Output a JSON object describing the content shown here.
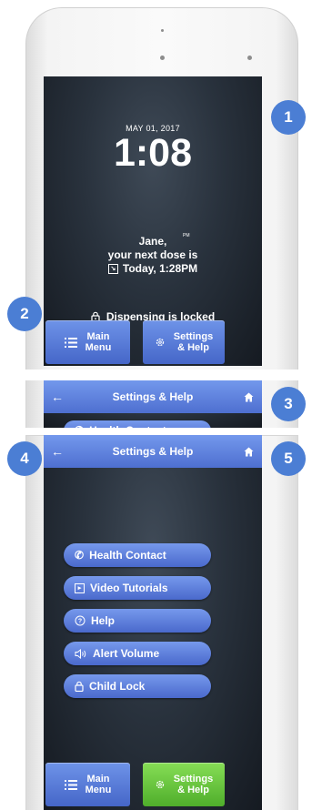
{
  "lock_screen": {
    "date": "MAY 01, 2017",
    "time": "1:08",
    "ampm": "PM",
    "greeting_name": "Jane,",
    "greeting_line": "your next dose is",
    "next_dose": "Today, 1:28PM",
    "lock_status": "Dispensing is locked",
    "main_menu_line1": "Main",
    "main_menu_line2": "Menu",
    "settings_line1": "Settings",
    "settings_line2": "& Help"
  },
  "settings_header": {
    "title": "Settings & Help"
  },
  "settings_menu": {
    "items": [
      {
        "label": "Health Contact",
        "icon": "phone-icon"
      },
      {
        "label": "Video Tutorials",
        "icon": "video-icon"
      },
      {
        "label": "Help",
        "icon": "help-icon"
      },
      {
        "label": "Alert Volume",
        "icon": "speaker-icon"
      },
      {
        "label": "Child Lock",
        "icon": "lock-icon"
      }
    ],
    "main_menu_line1": "Main",
    "main_menu_line2": "Menu",
    "settings_line1": "Settings",
    "settings_line2": "& Help"
  },
  "callouts": [
    "1",
    "2",
    "3",
    "4",
    "5"
  ],
  "colors": {
    "accent_blue": "#5a7fdc",
    "active_green": "#66c53d",
    "callout_blue": "#4b7ed4",
    "screen_dark": "#29323d"
  }
}
